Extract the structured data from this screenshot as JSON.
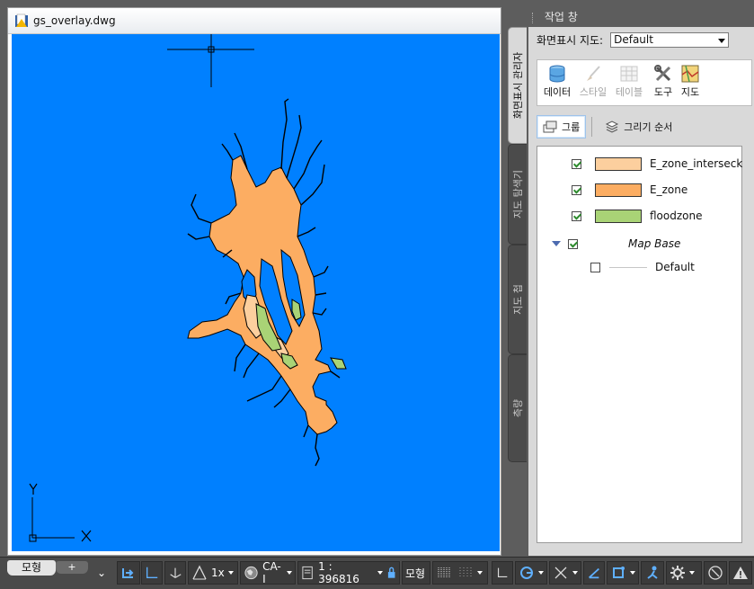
{
  "drawing": {
    "tab_title": "gs_overlay.dwg",
    "axis_x_label": "X",
    "axis_y_label": "Y",
    "background": "#0080ff",
    "colors": {
      "intersect": "#fccf9e",
      "e_zone": "#fcad62",
      "floodzone": "#a9d376"
    }
  },
  "taskpane": {
    "title": "작업 창",
    "vertical_tabs": [
      "화면표시 관리자",
      "지도 탐색기",
      "지도 첩",
      "측량"
    ],
    "display_map_label": "화면표시 지도:",
    "display_map_value": "Default",
    "tools": [
      {
        "label": "데이터",
        "icon": "database-icon",
        "enabled": true
      },
      {
        "label": "스타일",
        "icon": "brush-icon",
        "enabled": false
      },
      {
        "label": "테이블",
        "icon": "table-icon",
        "enabled": false
      },
      {
        "label": "도구",
        "icon": "tools-icon",
        "enabled": true
      },
      {
        "label": "지도",
        "icon": "map-icon",
        "enabled": true
      }
    ],
    "group_label": "그룹",
    "draw_order_label": "그리기 순서",
    "layers": [
      {
        "name": "E_zone_interseck",
        "checked": true,
        "color": "#fccf9e"
      },
      {
        "name": "E_zone",
        "checked": true,
        "color": "#fcad62"
      },
      {
        "name": "floodzone",
        "checked": true,
        "color": "#a9d376"
      }
    ],
    "base_group": {
      "name": "Map Base",
      "checked": true
    },
    "base_child": {
      "name": "Default",
      "checked": false
    }
  },
  "statusbar": {
    "model_tab": "모형",
    "add_tab": "+",
    "scale_factor": "1x",
    "coordinate_system": "CA-I",
    "scale": "1 : 396816",
    "model_label": "모형"
  }
}
